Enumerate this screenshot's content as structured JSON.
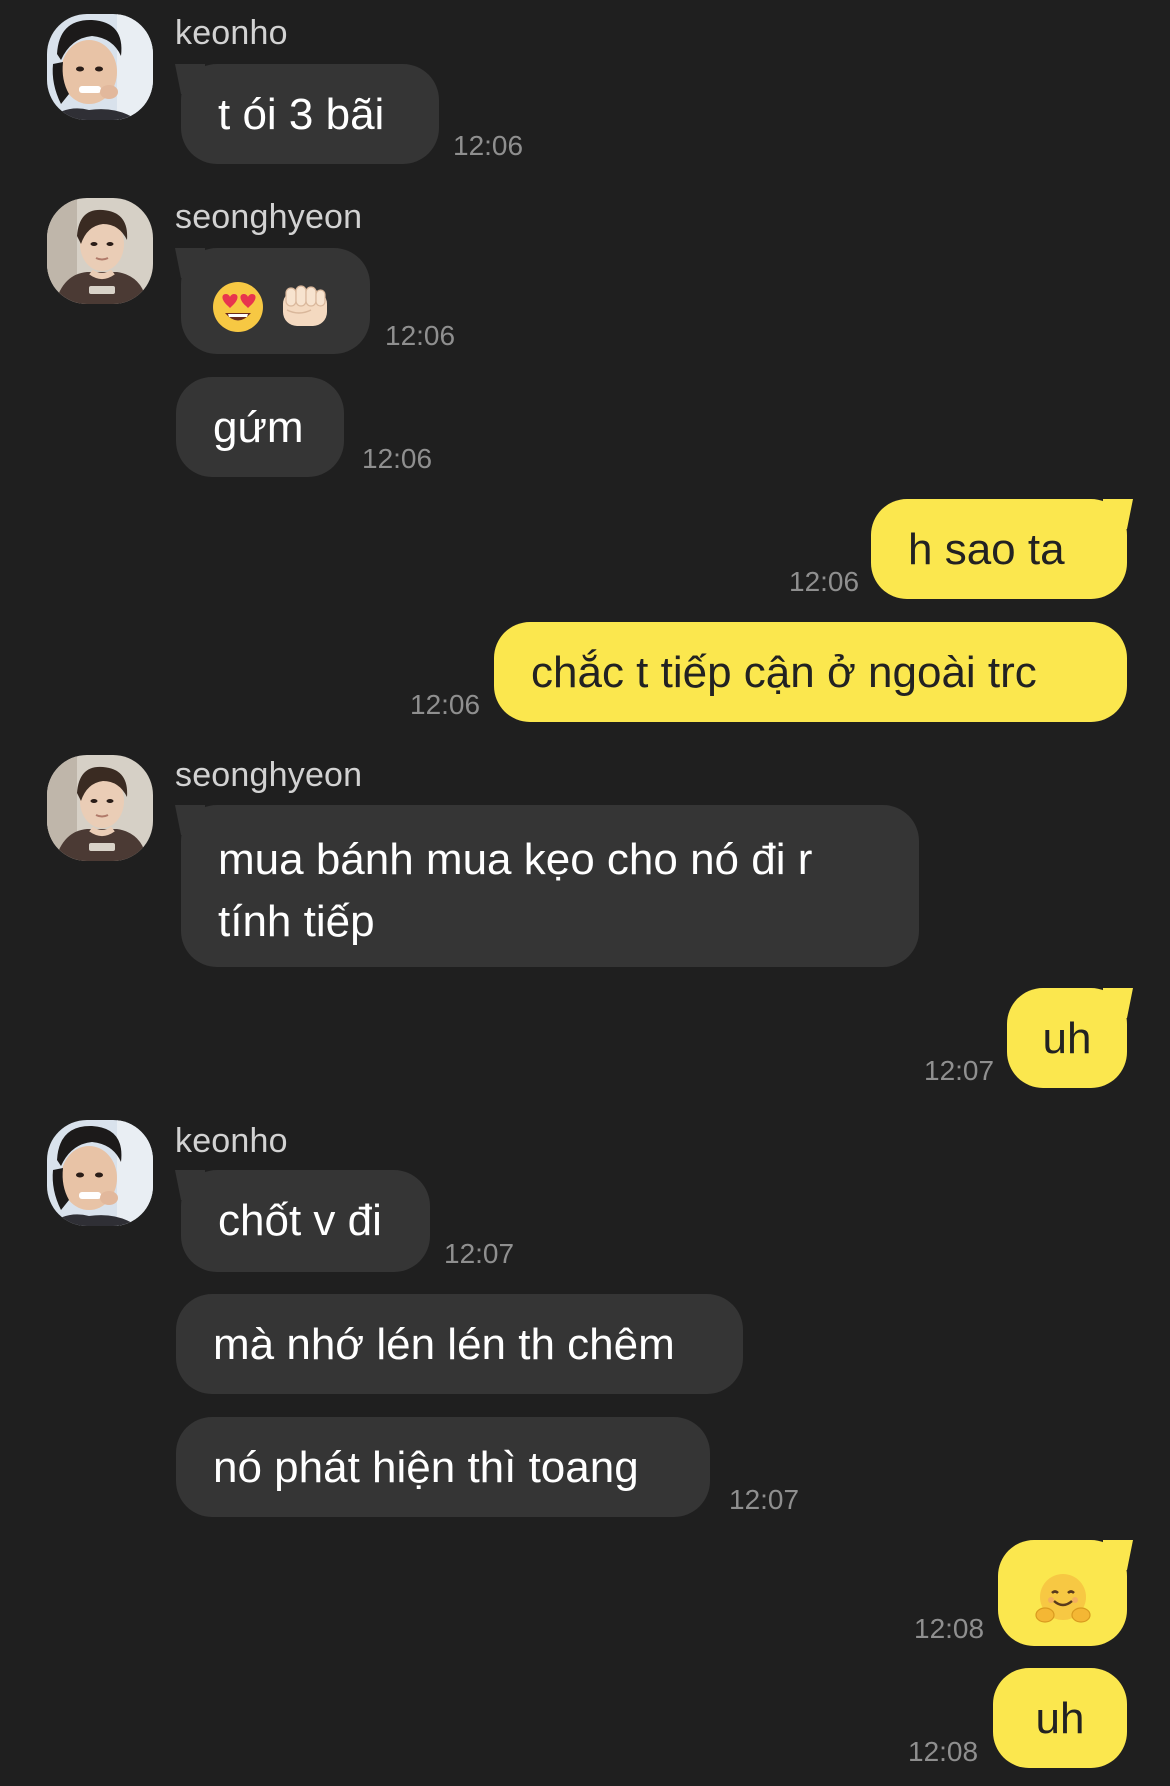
{
  "users": {
    "keonho": "keonho",
    "seonghyeon": "seonghyeon"
  },
  "messages": [
    {
      "text": "t ói 3 bãi",
      "time": "12:06"
    },
    {
      "emoji": [
        "heart-eyes-face",
        "oncoming-fist"
      ],
      "time": "12:06"
    },
    {
      "text": "gứm",
      "time": "12:06"
    },
    {
      "text": "h sao ta",
      "time": "12:06"
    },
    {
      "text": "chắc t tiếp cận ở ngoài trc",
      "time": "12:06"
    },
    {
      "text": "mua bánh mua kẹo cho nó đi r tính tiếp"
    },
    {
      "text": "uh",
      "time": "12:07"
    },
    {
      "text": "chốt v đi",
      "time": "12:07"
    },
    {
      "text": "mà nhớ lén lén th chêm"
    },
    {
      "text": "nó phát hiện thì toang",
      "time": "12:07"
    },
    {
      "emoji": [
        "hugging-face"
      ],
      "time": "12:08"
    },
    {
      "text": "uh",
      "time": "12:08"
    }
  ],
  "colors": {
    "background": "#1f1f1f",
    "incoming_bubble": "#353535",
    "outgoing_bubble": "#fbe74e",
    "timestamp": "#8f8f8f"
  }
}
